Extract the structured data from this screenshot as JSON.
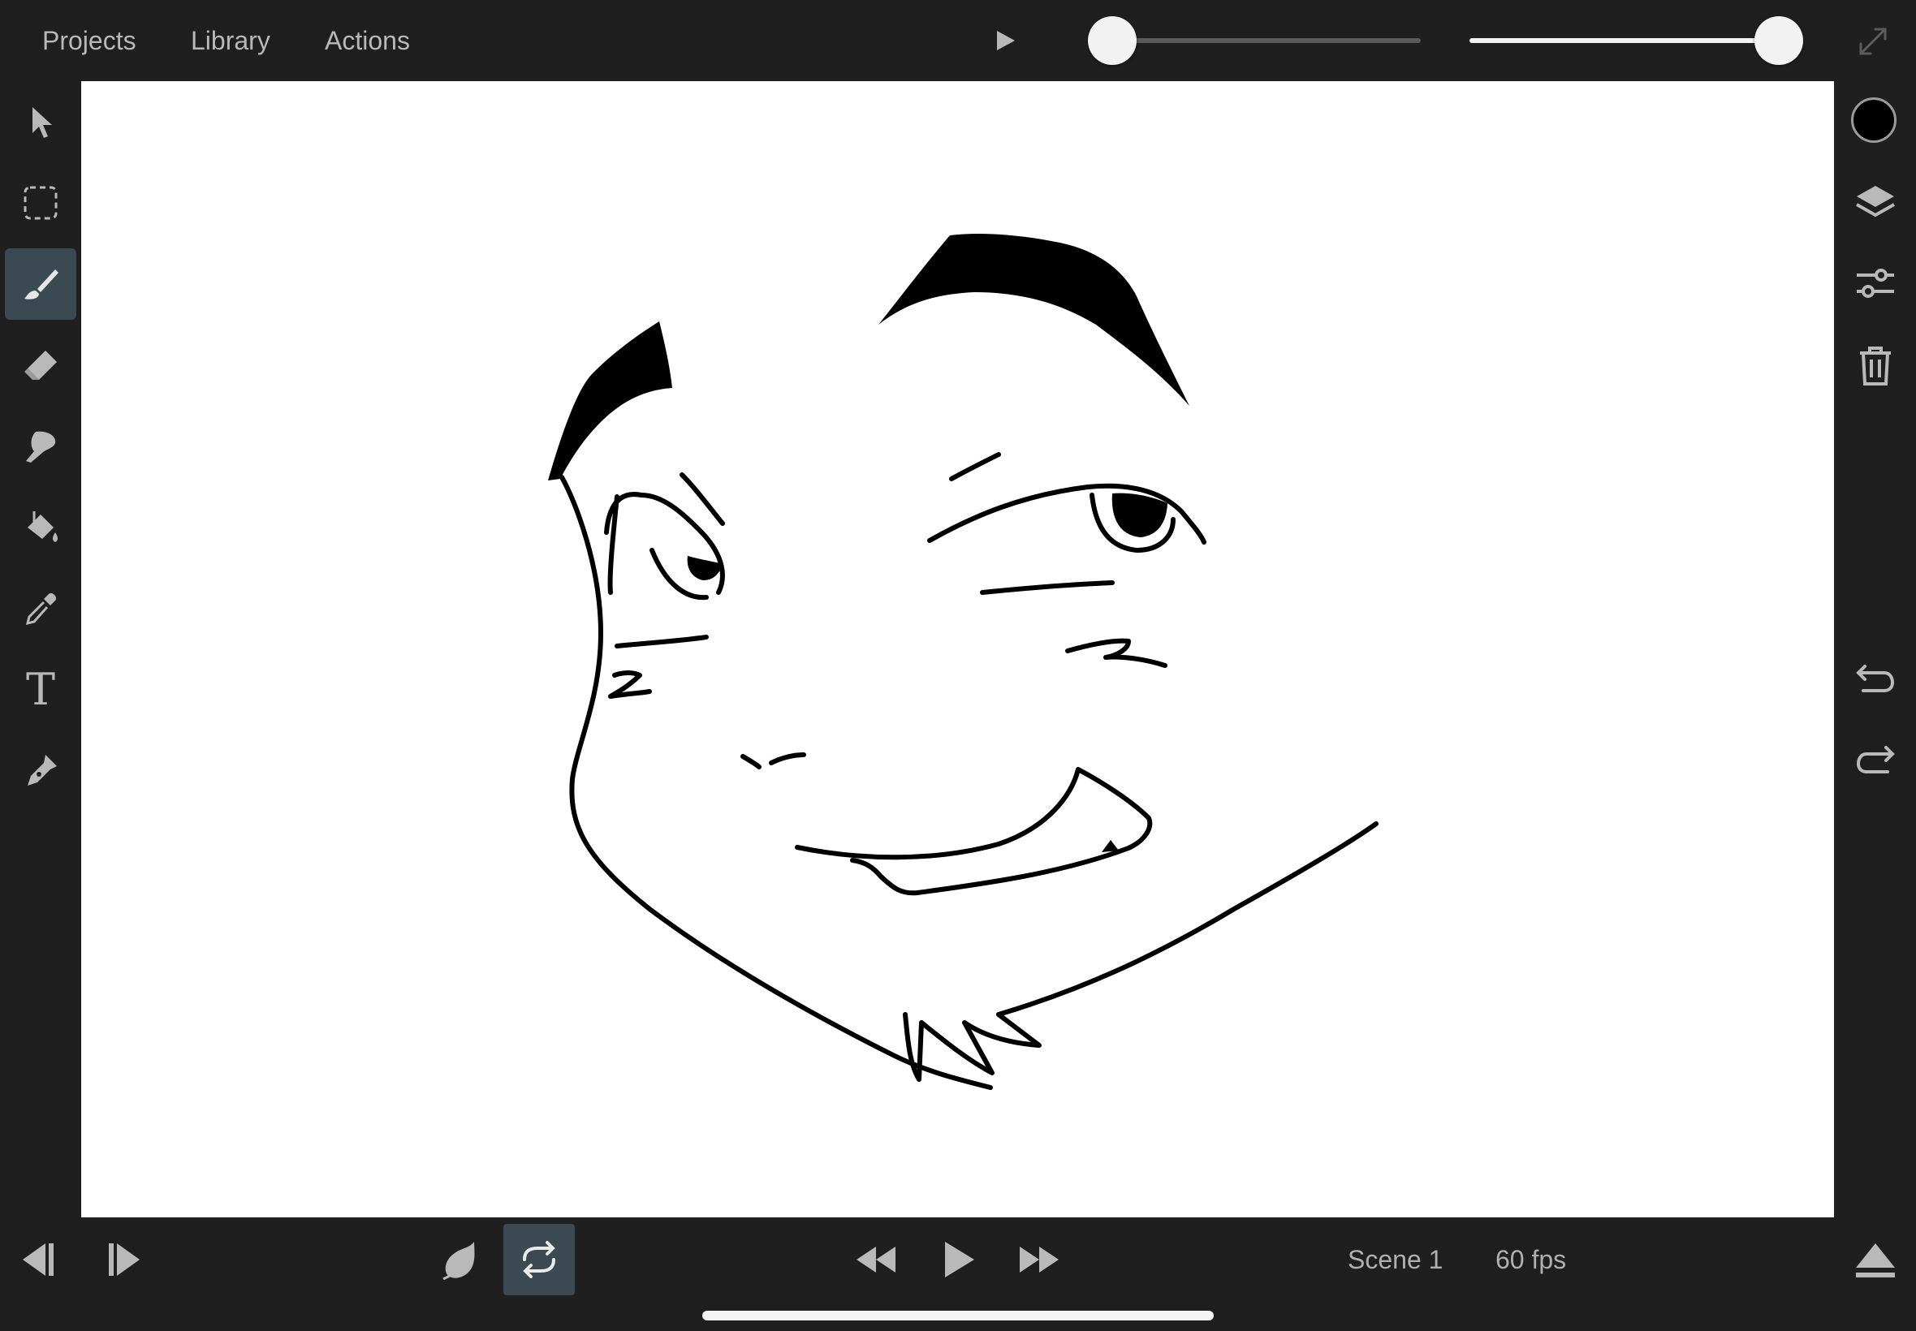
{
  "menu": {
    "projects": "Projects",
    "library": "Library",
    "actions": "Actions"
  },
  "top_controls": {
    "scrubber_value": 0.0,
    "brush_size_value": 1.0
  },
  "left_tools": [
    {
      "name": "select",
      "icon": "arrow-pointer-icon"
    },
    {
      "name": "lasso",
      "icon": "dashed-selection-icon"
    },
    {
      "name": "brush",
      "icon": "brush-icon",
      "active": true
    },
    {
      "name": "eraser",
      "icon": "eraser-icon"
    },
    {
      "name": "smudge",
      "icon": "smudge-finger-icon"
    },
    {
      "name": "fill",
      "icon": "paint-bucket-icon"
    },
    {
      "name": "eyedropper",
      "icon": "eyedropper-icon"
    },
    {
      "name": "text",
      "icon": "text-icon",
      "glyph": "T"
    },
    {
      "name": "pen",
      "icon": "pen-nib-icon"
    }
  ],
  "right_tools": {
    "color": "#000000",
    "icons": [
      "layers-icon",
      "sliders-icon",
      "trash-icon",
      "undo-icon",
      "redo-icon"
    ]
  },
  "bottom_bar": {
    "scene_label": "Scene 1",
    "fps_label": "60 fps",
    "loop_active": true
  },
  "colors": {
    "background": "#1f1f1f",
    "canvas": "#ffffff",
    "active_tool": "#3b4a52",
    "stroke": "#000000"
  }
}
